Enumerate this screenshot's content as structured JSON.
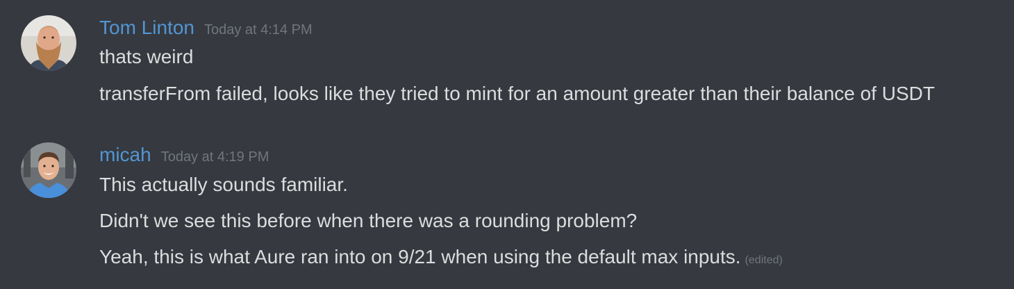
{
  "messages": [
    {
      "username": "Tom Linton",
      "timestamp": "Today at 4:14 PM",
      "avatar_icon": "bearded-man-avatar",
      "lines": [
        "thats weird",
        "transferFrom failed, looks like they tried to mint for an amount greater than their balance of USDT"
      ]
    },
    {
      "username": "micah",
      "timestamp": "Today at 4:19 PM",
      "avatar_icon": "smiling-man-avatar",
      "lines": [
        "This actually sounds familiar.",
        "Didn't we see this before when there was a rounding problem?",
        "Yeah, this is what Aure ran into on 9/21 when using the default max inputs."
      ],
      "edited_label": "(edited)"
    }
  ],
  "colors": {
    "background": "#36393f",
    "username": "#5296d5",
    "message_text": "#dcddde",
    "meta_text": "#72767d"
  }
}
